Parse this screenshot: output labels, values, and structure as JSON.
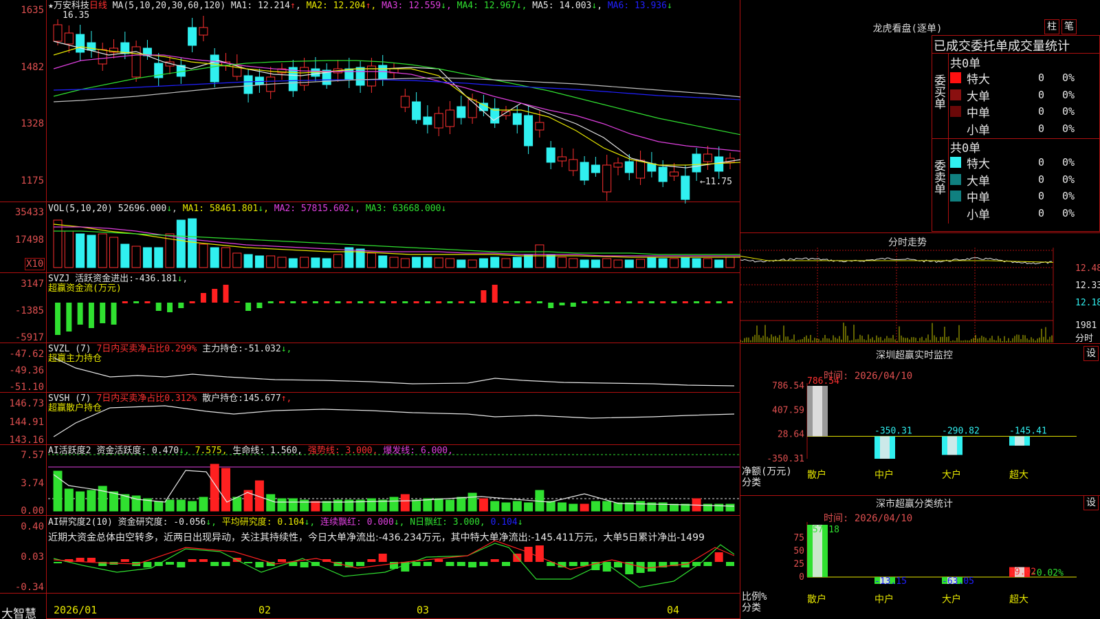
{
  "colors": {
    "up": "#ff3030",
    "down": "#30f0f0",
    "grid": "#b01010",
    "ma1": "#e8e8e8",
    "ma2": "#e8e800",
    "ma3": "#e040e0",
    "ma4": "#30e030",
    "ma5": "#2020ff",
    "ma6": "#c0c0c0"
  },
  "main": {
    "stock": "★万安科技",
    "period": "日线",
    "ma_label": "MA(5,10,20,30,60,120)",
    "ma": [
      {
        "label": "MA1:",
        "value": "12.214",
        "arrow": "↑"
      },
      {
        "label": "MA2:",
        "value": "12.204",
        "arrow": "↑"
      },
      {
        "label": "MA3:",
        "value": "12.559",
        "arrow": "↓"
      },
      {
        "label": "MA4:",
        "value": "12.967",
        "arrow": "↓"
      },
      {
        "label": "MA5:",
        "value": "14.003",
        "arrow": "↓"
      },
      {
        "label": "MA6:",
        "value": "13.936",
        "arrow": "↓"
      }
    ],
    "y_ticks": [
      "1635",
      "1482",
      "1328",
      "1175"
    ],
    "high_mark": "16.35",
    "low_mark": "←11.75"
  },
  "vol": {
    "label": "VOL(5,10,20)",
    "value": "52696.000",
    "arrow": "↓",
    "ma": [
      {
        "label": "MA1:",
        "value": "58461.801",
        "arrow": "↓"
      },
      {
        "label": "MA2:",
        "value": "57815.602",
        "arrow": "↓"
      },
      {
        "label": "MA3:",
        "value": "63668.000",
        "arrow": "↓"
      }
    ],
    "y_ticks": [
      "35433",
      "17498"
    ],
    "unit": "X10"
  },
  "svzj": {
    "label": "SVZJ",
    "title": "活跃资金进出:",
    "value": "-436.181",
    "arrow": "↓",
    "subtitle": "超赢资金流(万元)",
    "y_ticks": [
      "3147",
      "-1385",
      "-5917"
    ]
  },
  "svzl": {
    "label": "SVZL (7)",
    "ratio": "7日内买卖净占比0.299%",
    "title": "主力持仓:",
    "value": "-51.032",
    "arrow": "↓,",
    "subtitle": "超赢主力持仓",
    "y_ticks": [
      "-47.62",
      "-49.36",
      "-51.10"
    ]
  },
  "svsh": {
    "label": "SVSH (7)",
    "ratio": "7日内买卖净占比0.312%",
    "title": "散户持仓:",
    "value": "145.677",
    "arrow": "↑,",
    "subtitle": "超赢散户持仓",
    "y_ticks": [
      "146.73",
      "144.91",
      "143.16"
    ]
  },
  "active": {
    "label": "AI活跃度2",
    "title": "资金活跃度:",
    "value": "0.470",
    "arrow": "↓,",
    "v2": "7.575,",
    "life": "生命线:",
    "life_v": "1.560,",
    "strong": "强势线:",
    "strong_v": "3.000,",
    "burst": "爆发线:",
    "burst_v": "6.000,",
    "y_ticks": [
      "7.57",
      "3.74",
      "0.00"
    ]
  },
  "research": {
    "label": "AI研究度2(10)",
    "title": "资金研究度:",
    "value": "-0.056",
    "arrow": "↓,",
    "avg": "平均研究度:",
    "avg_v": "0.104",
    "avg_a": "↓,",
    "red": "连续飘红:",
    "red_v": "0.000",
    "red_a": "↓,",
    "nred": "N日飘红:",
    "nred_v": "3.000,",
    "last": "0.104",
    "last_a": "↓",
    "comment": "近期大资金总体由空转多，近两日出现异动，关注其持续性，今日大单净流出:-436.234万元，其中特大单净流出:-145.411万元，大单5日累计净出-1499",
    "y_ticks": [
      "0.40",
      "0.03",
      "-0.34"
    ]
  },
  "xaxis": {
    "labels": [
      "2026/01",
      "02",
      "03",
      "04"
    ]
  },
  "brand": "大智慧",
  "lhb": {
    "title": "龙虎看盘(逐单)",
    "btn1": "柱",
    "btn2": "笔",
    "sub": "已成交委托单成交量统计",
    "buy": {
      "side": "委买单",
      "total": "共0单",
      "rows": [
        {
          "name": "特大",
          "n": "0",
          "p": "0%"
        },
        {
          "name": "大单",
          "n": "0",
          "p": "0%"
        },
        {
          "name": "中单",
          "n": "0",
          "p": "0%"
        },
        {
          "name": "小单",
          "n": "0",
          "p": "0%"
        }
      ]
    },
    "sell": {
      "side": "委卖单",
      "total": "共0单",
      "rows": [
        {
          "name": "特大",
          "n": "0",
          "p": "0%"
        },
        {
          "name": "大单",
          "n": "0",
          "p": "0%"
        },
        {
          "name": "中单",
          "n": "0",
          "p": "0%"
        },
        {
          "name": "小单",
          "n": "0",
          "p": "0%"
        }
      ]
    }
  },
  "intraday": {
    "title": "分时走势",
    "y_ticks": [
      "12.48",
      "12.33",
      "12.18"
    ],
    "vol_tick": "1981",
    "vol_unit": "分时"
  },
  "monitor": {
    "title": "深圳超赢实时监控",
    "btn": "设",
    "time": "时间: 2026/04/10",
    "y_ticks": [
      "786.54",
      "407.59",
      "28.64",
      "-350.31"
    ],
    "ylabel": "净额(万元)",
    "xlabel": "分类",
    "chart_data": {
      "type": "bar",
      "categories": [
        "散户",
        "中户",
        "大户",
        "超大"
      ],
      "values": [
        786.54,
        -350.31,
        -290.82,
        -145.41
      ],
      "ylim": [
        -350.31,
        786.54
      ]
    }
  },
  "classify": {
    "title": "深市超赢分类统计",
    "btn": "设",
    "time": "时间: 2026/04/10",
    "y_ticks": [
      "75",
      "50",
      "25",
      "0"
    ],
    "ylabel": "比例%",
    "xlabel": "分类",
    "note": "-0.02%",
    "chart_data": {
      "type": "bar",
      "categories": [
        "散户",
        "中户",
        "大户",
        "超大"
      ],
      "values": [
        157.18,
        -13.15,
        -63.05,
        19.02
      ],
      "ylim": [
        0,
        100
      ]
    }
  }
}
